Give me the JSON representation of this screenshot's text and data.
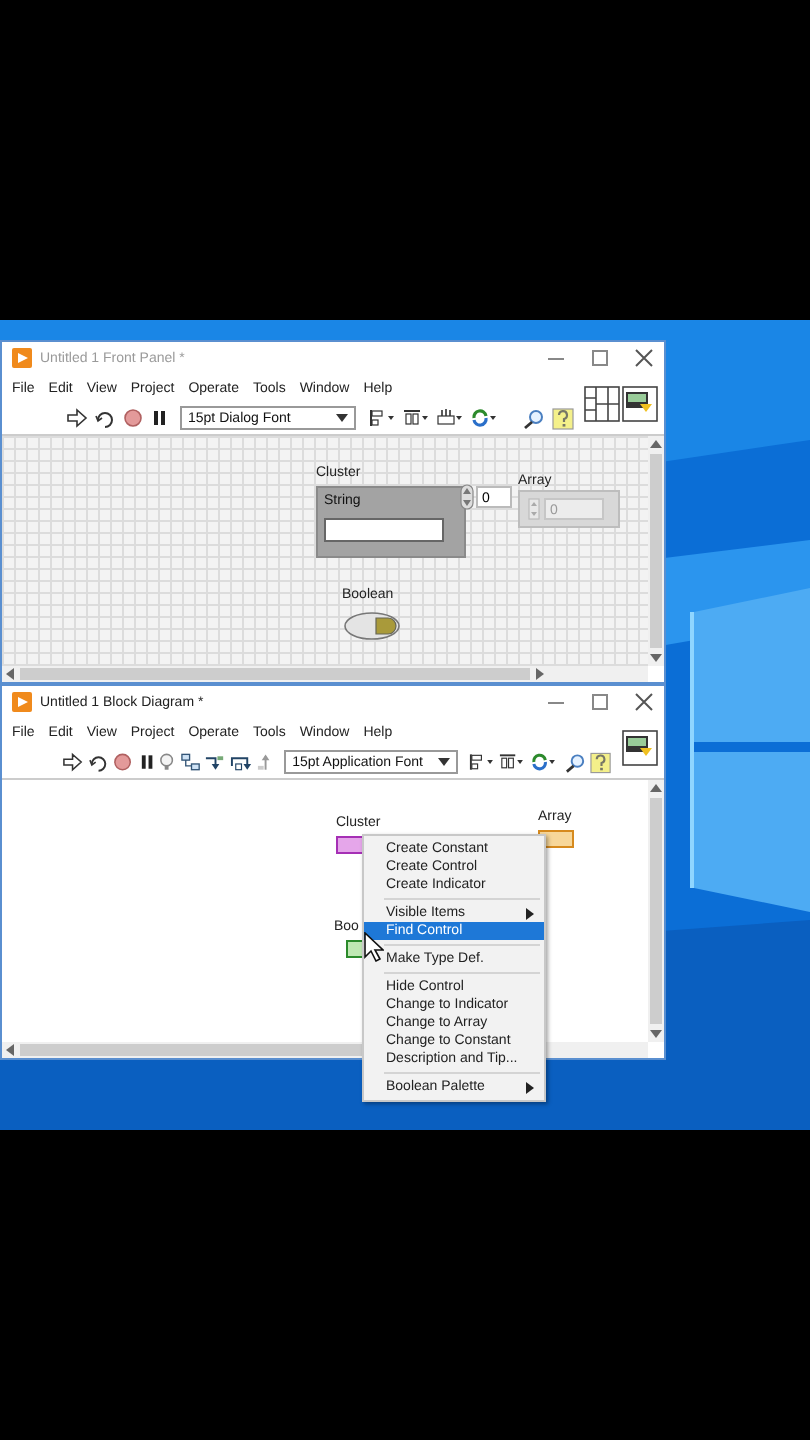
{
  "windows": [
    {
      "kind": "front_panel",
      "title": "Untitled 1 Front Panel *",
      "active": false,
      "menu": [
        "File",
        "Edit",
        "View",
        "Project",
        "Operate",
        "Tools",
        "Window",
        "Help"
      ],
      "font": "15pt Dialog Font",
      "items": [
        {
          "kind": "cluster",
          "label": "Cluster",
          "inner_label": "String"
        },
        {
          "kind": "array",
          "label": "Array",
          "index": "0",
          "element": "0"
        },
        {
          "kind": "boolean",
          "label": "Boolean",
          "on": false
        }
      ]
    },
    {
      "kind": "block_diagram",
      "title": "Untitled 1 Block Diagram *",
      "active": true,
      "menu": [
        "File",
        "Edit",
        "View",
        "Project",
        "Operate",
        "Tools",
        "Window",
        "Help"
      ],
      "font": "15pt Application Font",
      "items": [
        {
          "kind": "cluster",
          "label": "Cluster"
        },
        {
          "kind": "array",
          "label": "Array"
        },
        {
          "kind": "boolean",
          "label": "Boo"
        }
      ]
    }
  ],
  "context_menu": {
    "groups": [
      [
        {
          "label": "Create Constant",
          "selected": false,
          "submenu": false
        },
        {
          "label": "Create Control",
          "selected": false,
          "submenu": false
        },
        {
          "label": "Create Indicator",
          "selected": false,
          "submenu": false
        }
      ],
      [
        {
          "label": "Visible Items",
          "selected": false,
          "submenu": true
        },
        {
          "label": "Find Control",
          "selected": true,
          "submenu": false
        }
      ],
      [
        {
          "label": "Make Type Def.",
          "selected": false,
          "submenu": false
        }
      ],
      [
        {
          "label": "Hide Control",
          "selected": false,
          "submenu": false
        },
        {
          "label": "Change to Indicator",
          "selected": false,
          "submenu": false
        },
        {
          "label": "Change to Array",
          "selected": false,
          "submenu": false
        },
        {
          "label": "Change to Constant",
          "selected": false,
          "submenu": false
        },
        {
          "label": "Description and Tip...",
          "selected": false,
          "submenu": false
        }
      ],
      [
        {
          "label": "Boolean Palette",
          "selected": false,
          "submenu": true
        }
      ]
    ]
  }
}
